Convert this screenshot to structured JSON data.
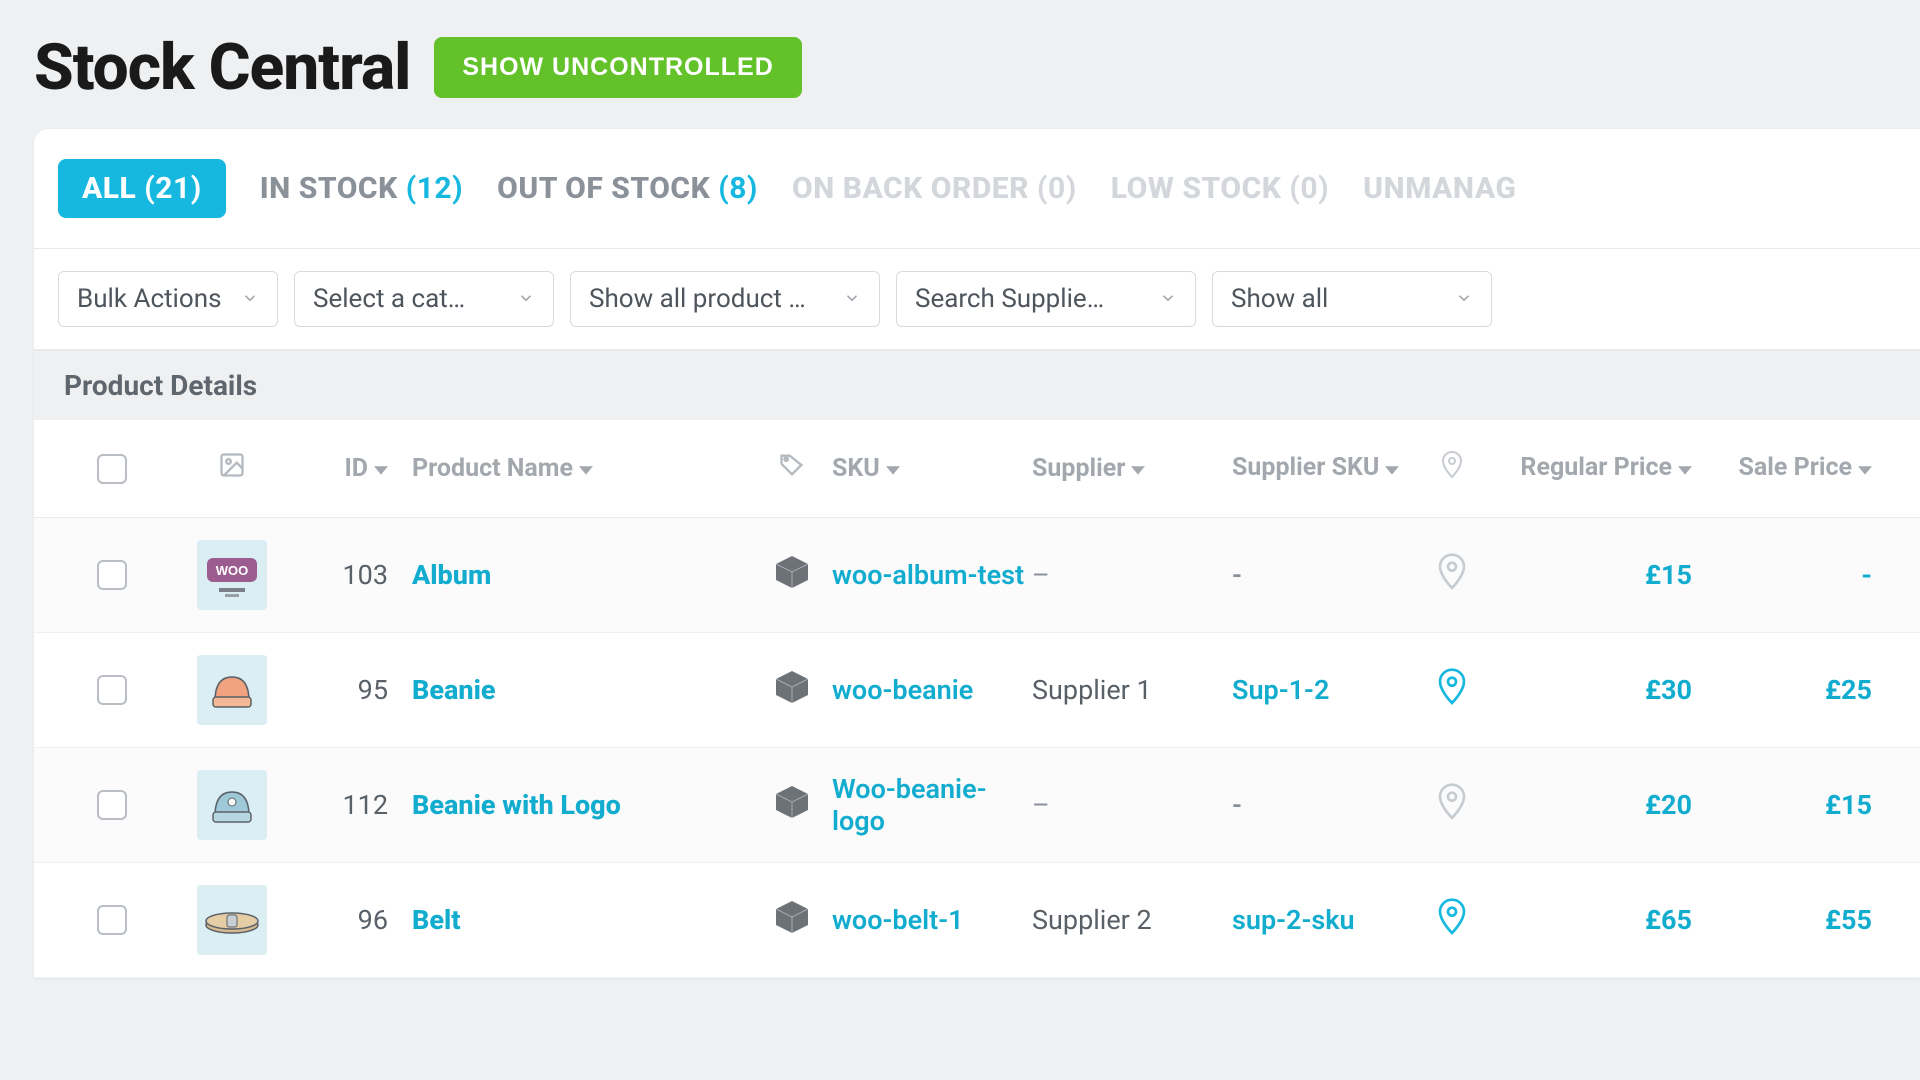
{
  "header": {
    "title": "Stock Central",
    "uncontrolled_btn": "SHOW UNCONTROLLED"
  },
  "tabs": [
    {
      "label": "ALL",
      "count": "(21)",
      "active": true
    },
    {
      "label": "IN STOCK",
      "count": "(12)",
      "active": false
    },
    {
      "label": "OUT OF STOCK",
      "count": "(8)",
      "active": false
    },
    {
      "label": "ON BACK ORDER",
      "count": "(0)",
      "active": false,
      "faded": true
    },
    {
      "label": "LOW STOCK",
      "count": "(0)",
      "active": false,
      "faded": true
    },
    {
      "label": "UNMANAG",
      "count": "",
      "active": false,
      "faded": true
    }
  ],
  "filters": {
    "bulk": "Bulk Actions",
    "category": "Select a cat…",
    "product_type": "Show all product …",
    "supplier": "Search Supplie…",
    "show_all": "Show all"
  },
  "section_header": "Product Details",
  "columns": {
    "id": "ID",
    "product_name": "Product Name",
    "sku": "SKU",
    "supplier": "Supplier",
    "supplier_sku": "Supplier SKU",
    "regular_price": "Regular Price",
    "sale_price": "Sale Price"
  },
  "rows": [
    {
      "id": "103",
      "name": "Album",
      "thumb": "woo",
      "sku": "woo-album-test",
      "supplier": "–",
      "supplier_sku": "-",
      "pin_active": false,
      "regular": "£15",
      "sale": "-"
    },
    {
      "id": "95",
      "name": "Beanie",
      "thumb": "beanie-orange",
      "sku": "woo-beanie",
      "supplier": "Supplier 1",
      "supplier_sku": "Sup-1-2",
      "pin_active": true,
      "regular": "£30",
      "sale": "£25"
    },
    {
      "id": "112",
      "name": "Beanie with Logo",
      "thumb": "beanie-blue",
      "sku": "Woo-beanie-logo",
      "supplier": "–",
      "supplier_sku": "-",
      "pin_active": false,
      "regular": "£20",
      "sale": "£15"
    },
    {
      "id": "96",
      "name": "Belt",
      "thumb": "belt",
      "sku": "woo-belt-1",
      "supplier": "Supplier 2",
      "supplier_sku": "sup-2-sku",
      "pin_active": true,
      "regular": "£65",
      "sale": "£55"
    }
  ],
  "colors": {
    "accent": "#16b8e0",
    "link": "#12accf",
    "green": "#63c12a",
    "muted": "#8b9199"
  }
}
